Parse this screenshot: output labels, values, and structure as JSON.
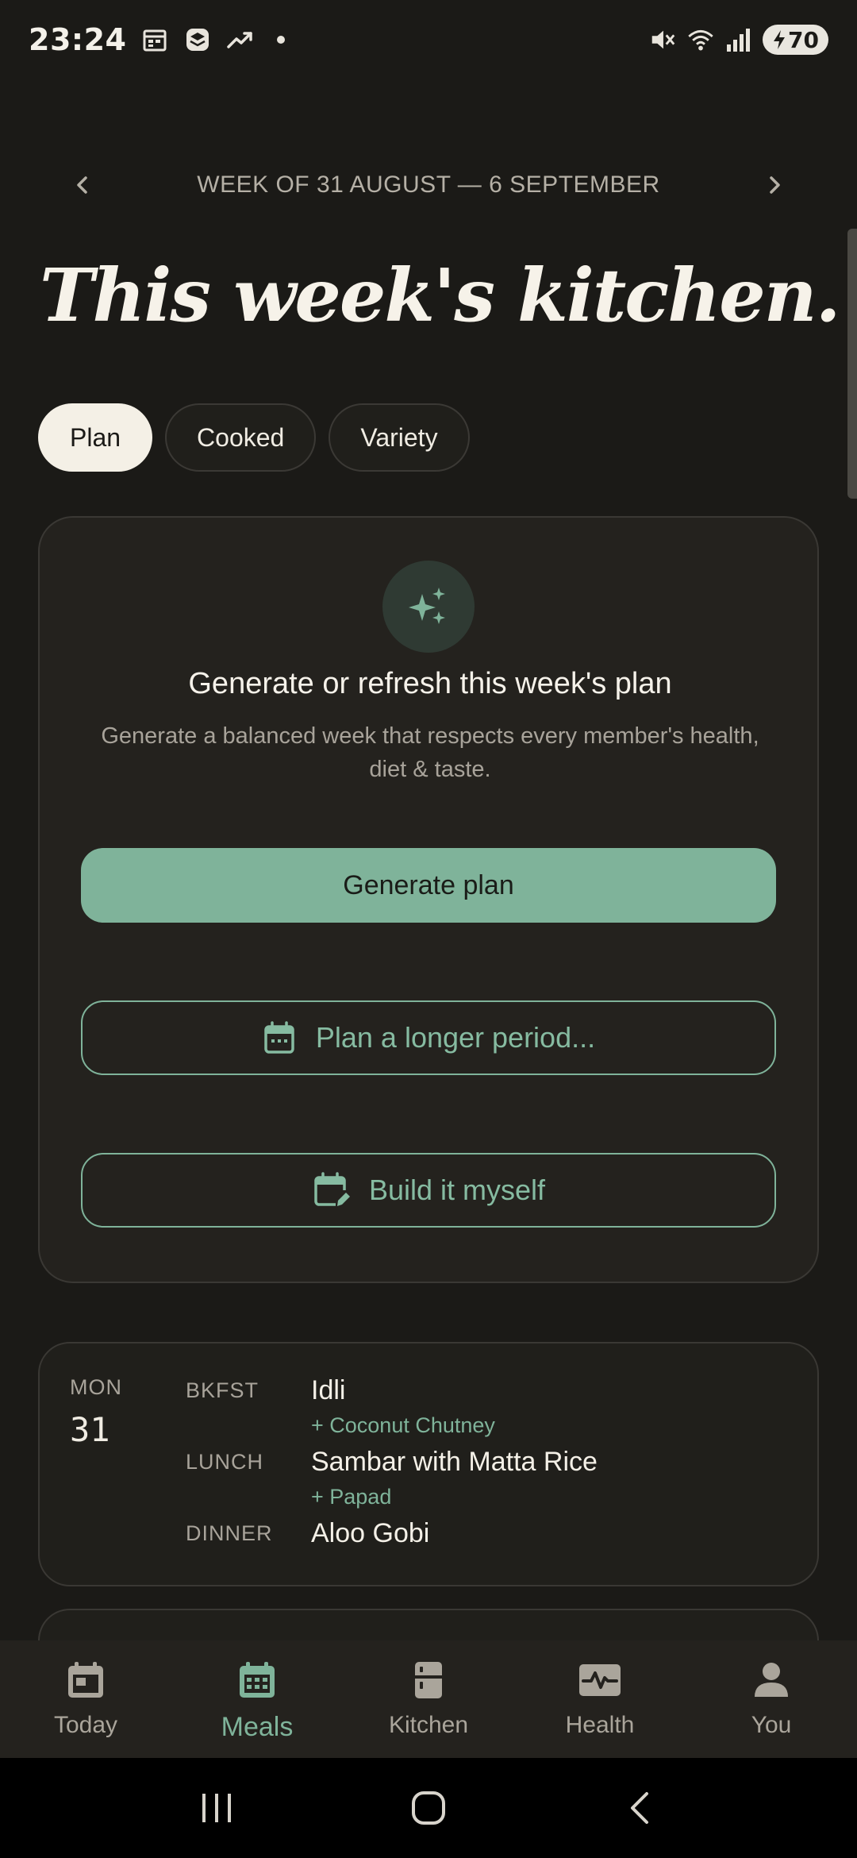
{
  "status_bar": {
    "time": "23:24",
    "battery": "70",
    "left_icons": [
      "calendar-icon",
      "stack-icon",
      "trending-icon"
    ],
    "right_icons": [
      "mute-icon",
      "wifi-icon",
      "signal-icon",
      "battery-icon"
    ]
  },
  "week_nav": {
    "label": "WEEK OF 31 AUGUST — 6 SEPTEMBER"
  },
  "page_title": "This week's kitchen.",
  "tabs": [
    {
      "label": "Plan",
      "active": true
    },
    {
      "label": "Cooked",
      "active": false
    },
    {
      "label": "Variety",
      "active": false
    }
  ],
  "generate_card": {
    "title": "Generate or refresh this week's plan",
    "subtitle": "Generate a balanced week that respects every member's health, diet & taste.",
    "primary_button": "Generate plan",
    "longer_button": "Plan a longer period...",
    "build_button": "Build it myself"
  },
  "day_card": {
    "dow": "MON",
    "day": "31",
    "meals": [
      {
        "label": "BKFST",
        "name": "Idli",
        "side": "+ Coconut Chutney"
      },
      {
        "label": "LUNCH",
        "name": "Sambar with Matta Rice",
        "side": "+ Papad"
      },
      {
        "label": "DINNER",
        "name": "Aloo Gobi",
        "side": ""
      }
    ]
  },
  "bottom_nav": [
    {
      "label": "Today",
      "icon": "calendar-day-icon",
      "active": false
    },
    {
      "label": "Meals",
      "icon": "calendar-grid-icon",
      "active": true
    },
    {
      "label": "Kitchen",
      "icon": "fridge-icon",
      "active": false
    },
    {
      "label": "Health",
      "icon": "pulse-icon",
      "active": false
    },
    {
      "label": "You",
      "icon": "person-icon",
      "active": false
    }
  ],
  "colors": {
    "background": "#1b1a17",
    "accent": "#7fb39a",
    "card": "#24221e"
  }
}
